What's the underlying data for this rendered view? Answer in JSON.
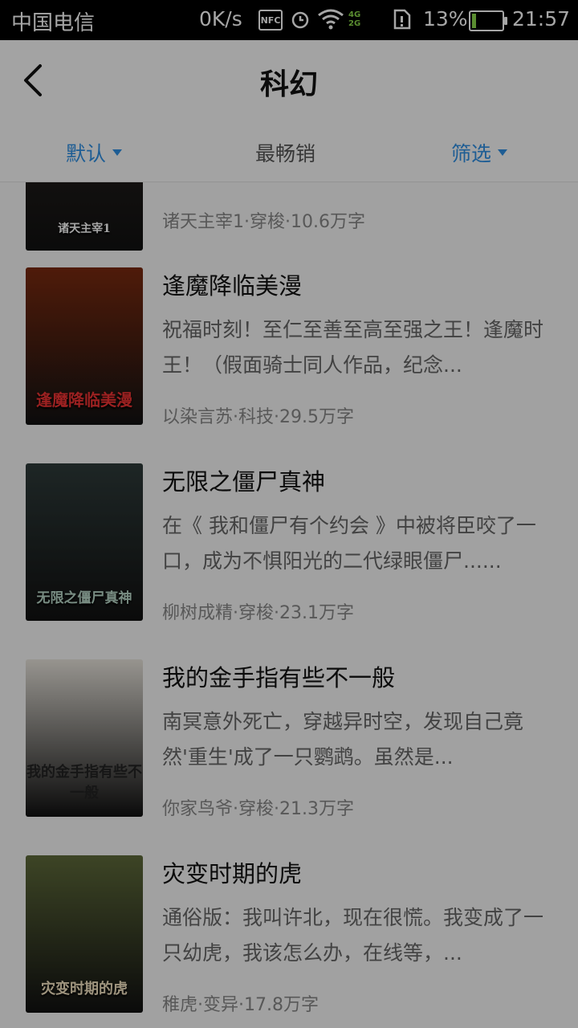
{
  "status_bar": {
    "carrier": "中国电信",
    "speed": "0K/s",
    "nfc_label": "NFC",
    "network_top": "4G",
    "network_bottom": "2G",
    "battery_percent": "13%",
    "battery_level": 0.13,
    "time": "21:57"
  },
  "header": {
    "title": "科幻"
  },
  "tabs": [
    {
      "label": "默认",
      "active": true
    },
    {
      "label": "最畅销",
      "active": false
    },
    {
      "label": "筛选",
      "active": false
    }
  ],
  "books": [
    {
      "title": "",
      "description": "",
      "meta": "诸天主宰1·穿梭·10.6万字",
      "cover_text": "诸天主宰1",
      "cover_color": "#2b2420"
    },
    {
      "title": "逢魔降临美漫",
      "description": "祝福时刻！至仁至善至高至强之王！逢魔时王！（假面骑士同人作品，纪念...",
      "meta": "以染言苏·科技·29.5万字",
      "cover_text": "逢魔降临美漫",
      "cover_color": "#7a2a10"
    },
    {
      "title": "无限之僵尸真神",
      "description": "在《 我和僵尸有个约会 》中被将臣咬了一口，成为不惧阳光的二代绿眼僵尸......",
      "meta": "柳树成精·穿梭·23.1万字",
      "cover_text": "无限之僵尸真神",
      "cover_color": "#2e3b3a"
    },
    {
      "title": "我的金手指有些不一般",
      "description": "南冥意外死亡，穿越异时空，发现自己竟然'重生'成了一只鹦鹉。虽然是...",
      "meta": "你家鸟爷·穿梭·21.3万字",
      "cover_text": "我的金手指有些不一般",
      "cover_color": "#e8e4dc"
    },
    {
      "title": "灾变时期的虎",
      "description": "通俗版：我叫许北，现在很慌。我变成了一只幼虎，我该怎么办，在线等，...",
      "meta": "稚虎·变异·17.8万字",
      "cover_text": "灾变时期的虎",
      "cover_color": "#5e6a3a"
    }
  ]
}
